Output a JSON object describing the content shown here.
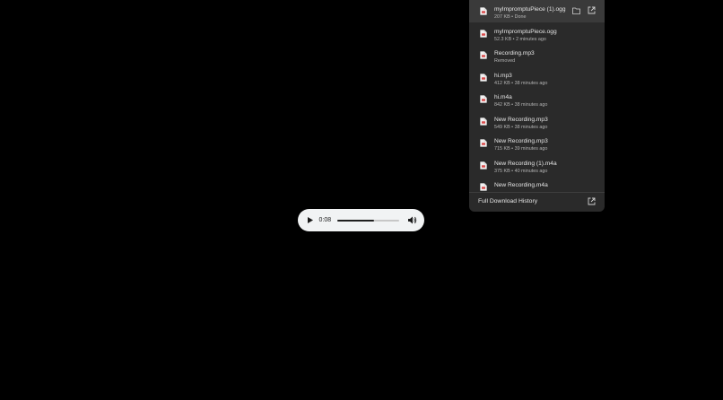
{
  "player": {
    "current_time": "0:08",
    "progress_percent": 60,
    "play_icon": "play-icon",
    "volume_icon": "volume-icon"
  },
  "downloads": {
    "items": [
      {
        "name": "myImpromptuPiece (1).ogg",
        "meta": "207 KB • Done",
        "active": true
      },
      {
        "name": "myImpromptuPiece.ogg",
        "meta": "52.3 KB • 2 minutes ago"
      },
      {
        "name": "Recording.mp3",
        "meta": "Removed"
      },
      {
        "name": "hi.mp3",
        "meta": "412 KB • 38 minutes ago"
      },
      {
        "name": "hi.m4a",
        "meta": "842 KB • 38 minutes ago"
      },
      {
        "name": "New Recording.mp3",
        "meta": "549 KB • 38 minutes ago"
      },
      {
        "name": "New Recording.mp3",
        "meta": "715 KB • 39 minutes ago"
      },
      {
        "name": "New Recording (1).m4a",
        "meta": "375 KB • 40 minutes ago"
      },
      {
        "name": "New Recording.m4a",
        "meta": ""
      }
    ],
    "footer_label": "Full Download History",
    "icons": {
      "file": "file-icon",
      "folder": "folder-icon",
      "open": "open-external-icon"
    },
    "colors": {
      "panel_bg": "#2a2a2a",
      "active_bg": "#3a3a3a",
      "file_icon_accent": "#d94b4b"
    }
  }
}
